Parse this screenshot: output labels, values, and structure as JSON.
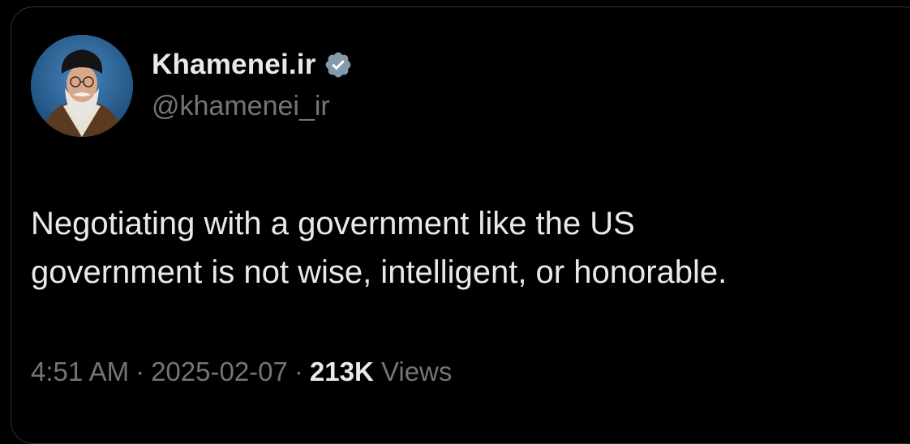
{
  "author": {
    "display_name": "Khamenei.ir",
    "handle": "@khamenei_ir",
    "verified": true,
    "avatar_icon": "profile-photo"
  },
  "tweet": {
    "text_line1": "Negotiating with a government like the US",
    "text_line2": "government is not wise, intelligent, or honorable.",
    "time": "4:51 AM",
    "date": "2025-02-07",
    "separator": "·",
    "views_count": "213K",
    "views_label": "Views"
  },
  "colors": {
    "background": "#000000",
    "primary_text": "#e7e9ea",
    "secondary_text": "#71767b",
    "verified_badge": "#829aab",
    "card_border": "#2f3336"
  }
}
